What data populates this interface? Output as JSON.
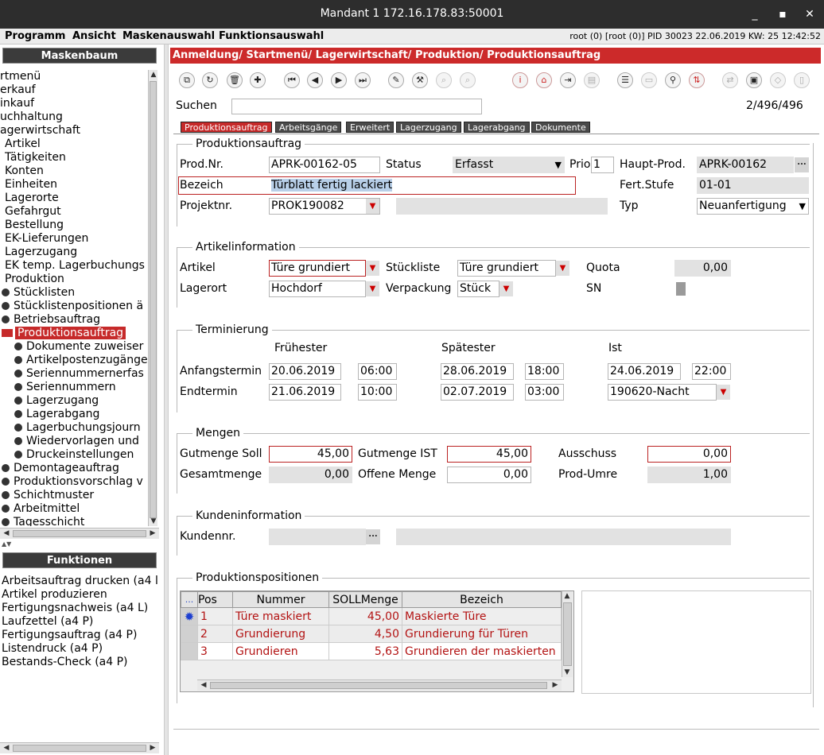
{
  "window": {
    "title": "Mandant 1 172.16.178.83:50001",
    "min": "_",
    "max": "▪",
    "close": "✕"
  },
  "menu": [
    "Programm",
    "Ansicht",
    "Maskenauswahl",
    "Funktionsauswahl"
  ],
  "status": "root (0) [root (0)] PID 30023  22.06.2019 KW: 25  12:42:52",
  "maskenbaum": {
    "title": "Maskenbaum",
    "items": [
      "rtmenü",
      "erkauf",
      "inkauf",
      "uchhaltung",
      "agerwirtschaft",
      "Artikel",
      "Tätigkeiten",
      "Konten",
      "Einheiten",
      "Lagerorte",
      "Gefahrgut",
      "Bestellung",
      "EK-Lieferungen",
      "Lagerzugang",
      "EK temp. Lagerbuchungs",
      "Produktion",
      "Stücklisten",
      "Stücklistenpositionen ä",
      "Betriebsauftrag",
      "Produktionsauftrag",
      "Dokumente zuweiser",
      "Artikelpostenzugänge",
      "Seriennummernerfas",
      "Seriennummern",
      "Lagerzugang",
      "Lagerabgang",
      "Lagerbuchungsjourn",
      "Wiedervorlagen und",
      "Druckeinstellungen",
      "Demontageauftrag",
      "Produktionsvorschlag v",
      "Schichtmuster",
      "Arbeitmittel",
      "Tagesschicht"
    ]
  },
  "funktionen": {
    "title": "Funktionen",
    "items": [
      "Arbeitsauftrag drucken (a4 l",
      "Artikel produzieren",
      "Fertigungsnachweis (a4 L)",
      "Laufzettel (a4 P)",
      "Fertigungsauftrag (a4 P)",
      "Listendruck (a4 P)",
      "Bestands-Check (a4 P)"
    ]
  },
  "breadcrumb": "Anmeldung/ Startmenü/ Lagerwirtschaft/ Produktion/ Produktionsauftrag",
  "search": {
    "label": "Suchen",
    "value": "",
    "counter": "2/496/496"
  },
  "tabs": [
    "Produktionsauftrag",
    "Arbeitsgänge",
    "Erweitert",
    "Lagerzugang",
    "Lagerabgang",
    "Dokumente"
  ],
  "pa": {
    "group": "Produktionsauftrag",
    "prodnr_label": "Prod.Nr.",
    "prodnr": "APRK-00162-05",
    "status_label": "Status",
    "status": "Erfasst",
    "prio_label": "Prio",
    "prio": "1",
    "hauptprod_label": "Haupt-Prod.",
    "hauptprod": "APRK-00162",
    "bezeich_label": "Bezeich",
    "bezeich": "Türblatt fertig lackiert",
    "fertstufe_label": "Fert.Stufe",
    "fertstufe": "01-01",
    "projektnr_label": "Projektnr.",
    "projektnr": "PROK190082",
    "typ_label": "Typ",
    "typ": "Neuanfertigung"
  },
  "ai": {
    "group": "Artikelinformation",
    "artikel_label": "Artikel",
    "artikel": "Türe grundiert",
    "stueck_label": "Stückliste",
    "stueckliste": "Türe grundiert",
    "quota_label": "Quota",
    "quota": "0,00",
    "lagerort_label": "Lagerort",
    "lagerort": "Hochdorf",
    "verp_label": "Verpackung",
    "verpackung": "Stück",
    "sn_label": "SN"
  },
  "term": {
    "group": "Terminierung",
    "fr": "Frühester",
    "sp": "Spätester",
    "ist": "Ist",
    "anf_label": "Anfangstermin",
    "end_label": "Endtermin",
    "anf_fr_d": "20.06.2019",
    "anf_fr_t": "06:00",
    "anf_sp_d": "28.06.2019",
    "anf_sp_t": "18:00",
    "anf_ist_d": "24.06.2019",
    "anf_ist_t": "22:00",
    "end_fr_d": "21.06.2019",
    "end_fr_t": "10:00",
    "end_sp_d": "02.07.2019",
    "end_sp_t": "03:00",
    "end_ist": "190620-Nacht"
  },
  "mengen": {
    "group": "Mengen",
    "gsoll_label": "Gutmenge Soll",
    "gsoll": "45,00",
    "gist_label": "Gutmenge IST",
    "gist": "45,00",
    "aus_label": "Ausschuss",
    "aus": "0,00",
    "ges_label": "Gesamtmenge",
    "ges": "0,00",
    "off_label": "Offene Menge",
    "off": "0,00",
    "umre_label": "Prod-Umre",
    "umre": "1,00"
  },
  "kunde": {
    "group": "Kundeninformation",
    "label": "Kundennr."
  },
  "pos": {
    "group": "Produktionspositionen",
    "headers": [
      "...",
      "Pos",
      "Nummer",
      "SOLLMenge",
      "Bezeich"
    ],
    "rows": [
      [
        "1",
        "Türe maskiert",
        "45,00",
        "Maskierte Türe"
      ],
      [
        "2",
        "Grundierung",
        "4,50",
        "Grundierung für Türen"
      ],
      [
        "3",
        "Grundieren",
        "5,63",
        "Grundieren der maskierten"
      ]
    ]
  }
}
